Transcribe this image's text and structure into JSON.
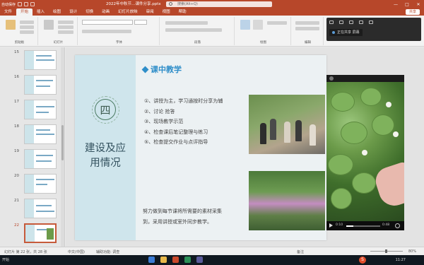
{
  "titlebar": {
    "app_name": "自动保存",
    "doc_title": "2022年中秋节…课件分享.pptx",
    "search_placeholder": "搜索(Alt+Q)",
    "win_min": "—",
    "win_max": "□",
    "win_close": "✕"
  },
  "menu": {
    "tabs": [
      "文件",
      "开始",
      "插入",
      "绘图",
      "设计",
      "切换",
      "动画",
      "幻灯片放映",
      "审阅",
      "视图",
      "帮助"
    ],
    "share": "共享"
  },
  "ribbon": {
    "groups": [
      "剪贴板",
      "幻灯片",
      "字体",
      "段落",
      "绘图",
      "编辑"
    ]
  },
  "meeting_panel": {
    "label": "正在共享 屏幕"
  },
  "thumbnails": {
    "numbers": [
      "15",
      "16",
      "17",
      "18",
      "19",
      "20",
      "21",
      "22"
    ],
    "selected": "22"
  },
  "slide": {
    "emblem": "四",
    "side_title_line1": "建设及应",
    "side_title_line2": "用情况",
    "heading": "课中教学",
    "items": [
      "①、讲授为主，学习通按时分享为辅",
      "②、讨论 抢答",
      "③、现场教学示范",
      "④、检查课后笔记整理与练习",
      "⑤、检查提交作业与点评指导"
    ],
    "summary_line1": "努力做到每节课将所需要的素材采集",
    "summary_line2": "到，采用讲授或室外同步教学。"
  },
  "video": {
    "time_current": "0:10",
    "time_total": "0:48",
    "progress_fraction": 0.21
  },
  "status": {
    "slide_info": "幻灯片 第 22 张，共 28 张",
    "language": "中文(中国)",
    "accessibility": "辅助功能: 调查",
    "notes": "备注",
    "zoom": "80%"
  },
  "taskbar": {
    "left_text": "开始",
    "time": "11:27"
  },
  "colors": {
    "accent": "#b7472a",
    "heading": "#2f8ec9",
    "slide_left_panel": "#cfe5ec"
  }
}
